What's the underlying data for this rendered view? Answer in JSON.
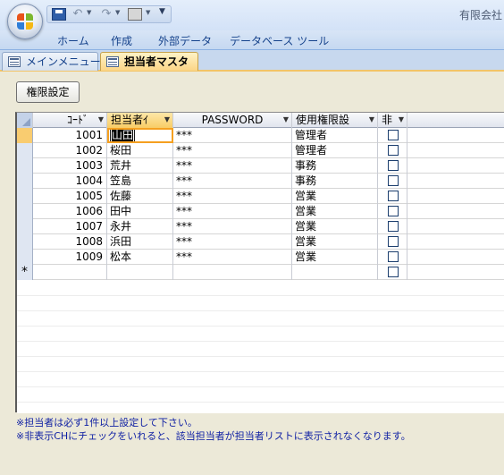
{
  "window": {
    "title": "有限会社"
  },
  "ribbon": {
    "tabs": [
      "ホーム",
      "作成",
      "外部データ",
      "データベース ツール"
    ]
  },
  "doc_tabs": [
    {
      "label": "メインメニュー",
      "active": false
    },
    {
      "label": "担当者マスタ",
      "active": true
    }
  ],
  "toolbar": {
    "perm_button": "権限設定"
  },
  "grid": {
    "columns": [
      "ｺｰﾄﾞ",
      "担当者ｲ",
      "PASSWORD",
      "使用権限設",
      "非"
    ],
    "rows": [
      {
        "code": "1001",
        "name": "山田",
        "password": "***",
        "role": "管理者",
        "hidden": false
      },
      {
        "code": "1002",
        "name": "桜田",
        "password": "***",
        "role": "管理者",
        "hidden": false
      },
      {
        "code": "1003",
        "name": "荒井",
        "password": "***",
        "role": "事務",
        "hidden": false
      },
      {
        "code": "1004",
        "name": "笠島",
        "password": "***",
        "role": "事務",
        "hidden": false
      },
      {
        "code": "1005",
        "name": "佐藤",
        "password": "***",
        "role": "営業",
        "hidden": false
      },
      {
        "code": "1006",
        "name": "田中",
        "password": "***",
        "role": "営業",
        "hidden": false
      },
      {
        "code": "1007",
        "name": "永井",
        "password": "***",
        "role": "営業",
        "hidden": false
      },
      {
        "code": "1008",
        "name": "浜田",
        "password": "***",
        "role": "営業",
        "hidden": false
      },
      {
        "code": "1009",
        "name": "松本",
        "password": "***",
        "role": "営業",
        "hidden": false
      }
    ],
    "new_row_marker": "*"
  },
  "notes": [
    "※担当者は必ず1件以上設定して下さい。",
    "※非表示CHにチェックをいれると、該当担当者が担当者リストに表示されなくなります。"
  ],
  "colors": {
    "accent": "#f8cd67",
    "ribbon_text": "#15428b",
    "note_text": "#0e1fa3"
  }
}
